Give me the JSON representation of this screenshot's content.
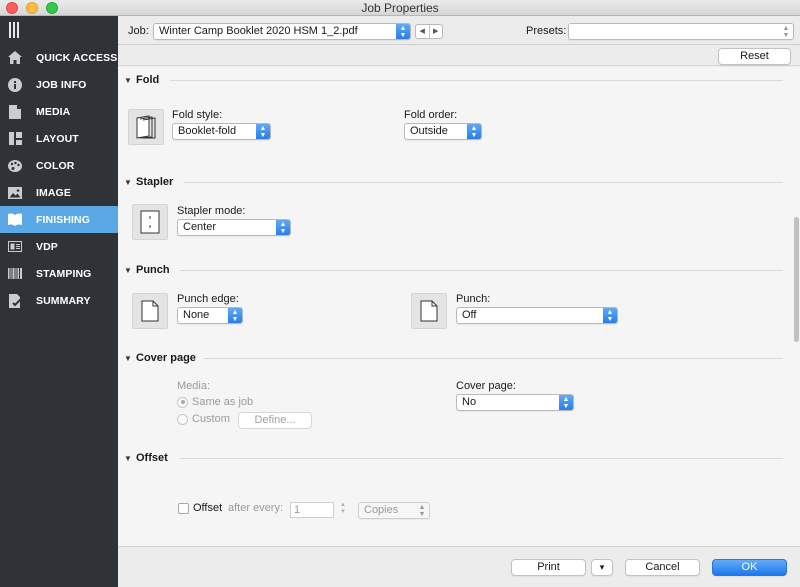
{
  "window": {
    "title": "Job Properties"
  },
  "sidebar": {
    "items": [
      {
        "label": "QUICK ACCESS",
        "icon": "home-icon",
        "active": false
      },
      {
        "label": "JOB INFO",
        "icon": "info-icon",
        "active": false
      },
      {
        "label": "MEDIA",
        "icon": "document-icon",
        "active": false
      },
      {
        "label": "LAYOUT",
        "icon": "layout-icon",
        "active": false
      },
      {
        "label": "COLOR",
        "icon": "palette-icon",
        "active": false
      },
      {
        "label": "IMAGE",
        "icon": "image-icon",
        "active": false
      },
      {
        "label": "FINISHING",
        "icon": "book-icon",
        "active": true
      },
      {
        "label": "VDP",
        "icon": "vdp-icon",
        "active": false
      },
      {
        "label": "STAMPING",
        "icon": "barcode-icon",
        "active": false
      },
      {
        "label": "SUMMARY",
        "icon": "summary-icon",
        "active": false
      }
    ]
  },
  "jobbar": {
    "job_label": "Job:",
    "job_value": "Winter Camp Booklet 2020 HSM 1_2.pdf",
    "presets_label": "Presets:",
    "presets_value": ""
  },
  "toolbar": {
    "reset_label": "Reset"
  },
  "sections": {
    "fold": {
      "title": "Fold",
      "style_label": "Fold style:",
      "style_value": "Booklet-fold",
      "order_label": "Fold order:",
      "order_value": "Outside"
    },
    "stapler": {
      "title": "Stapler",
      "mode_label": "Stapler mode:",
      "mode_value": "Center"
    },
    "punch": {
      "title": "Punch",
      "edge_label": "Punch edge:",
      "edge_value": "None",
      "punch_label": "Punch:",
      "punch_value": "Off"
    },
    "cover": {
      "title": "Cover page",
      "media_label": "Media:",
      "radio_same": "Same as job",
      "radio_custom": "Custom",
      "define_label": "Define...",
      "cover_label": "Cover page:",
      "cover_value": "No"
    },
    "offset": {
      "title": "Offset",
      "checkbox_label": "Offset",
      "after_label": "after every:",
      "count_value": "1",
      "unit_value": "Copies"
    }
  },
  "footer": {
    "print_label": "Print",
    "more_label": "▾",
    "cancel_label": "Cancel",
    "ok_label": "OK"
  },
  "colors": {
    "sidebar_bg": "#2f3338",
    "active_bg": "#5aa8e6",
    "accent": "#2a7de9"
  }
}
